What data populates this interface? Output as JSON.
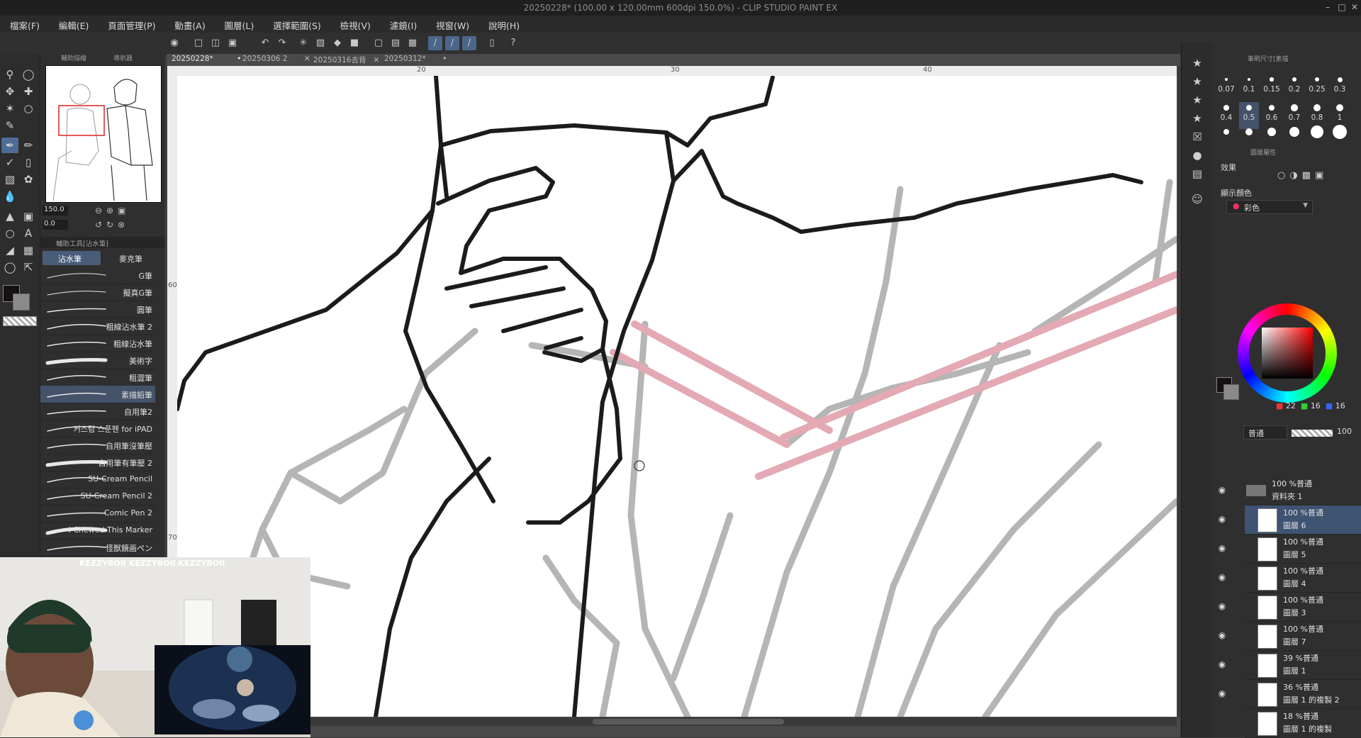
{
  "window": {
    "title": "20250228* (100.00 x 120.00mm 600dpi 150.0%)  - CLIP STUDIO PAINT EX",
    "minimize_icon": "minimize-icon",
    "maximize_icon": "maximize-icon",
    "close_icon": "close-icon"
  },
  "menu": [
    "檔案(F)",
    "編輯(E)",
    "頁面管理(P)",
    "動畫(A)",
    "圖層(L)",
    "選擇範圍(S)",
    "檢視(V)",
    "濾鏡(I)",
    "視窗(W)",
    "說明(H)"
  ],
  "document_tabs": [
    {
      "label": "20250228*",
      "active": true
    },
    {
      "label": "20250306 2",
      "active": false
    },
    {
      "label": "20250316去背",
      "active": false
    },
    {
      "label": "20250312*",
      "active": false
    }
  ],
  "rulers": {
    "top_marks": [
      "20",
      "30",
      "40"
    ],
    "left_marks": [
      "60",
      "70"
    ]
  },
  "navigator": {
    "tabs": [
      "輔助描繪",
      "導航器"
    ],
    "zoom": "150.0",
    "rotation": "0.0"
  },
  "subtool": {
    "panel_title": "輔助工具[沾水筆]",
    "groups": [
      "沾水筆",
      "麥克筆"
    ],
    "items": [
      {
        "label": "G筆",
        "selected": false
      },
      {
        "label": "擬真G筆",
        "selected": false
      },
      {
        "label": "圓筆",
        "selected": false
      },
      {
        "label": "粗線沾水筆 2",
        "selected": false
      },
      {
        "label": "粗線沾水筆",
        "selected": false
      },
      {
        "label": "美術字",
        "selected": false
      },
      {
        "label": "粗澀筆",
        "selected": false
      },
      {
        "label": "素描鉛筆",
        "selected": true
      },
      {
        "label": "自用筆2",
        "selected": false
      },
      {
        "label": "커스텀 스푼펜 for iPAD",
        "selected": false
      },
      {
        "label": "自用筆沒筆壓",
        "selected": false
      },
      {
        "label": "自用筆有筆壓 2",
        "selected": false
      },
      {
        "label": "SU-Cream Pencil",
        "selected": false
      },
      {
        "label": "SU-Cream Pencil 2",
        "selected": false
      },
      {
        "label": "Comic Pen 2",
        "selected": false
      },
      {
        "label": "I Chewed This Marker",
        "selected": false
      },
      {
        "label": "怪獣鏡画ペン",
        "selected": false
      }
    ]
  },
  "brush_size": {
    "panel_title": "筆刷尺寸[素描",
    "sizes": [
      "0.07",
      "0.1",
      "0.15",
      "0.2",
      "0.25",
      "0.3",
      "0.4",
      "0.5",
      "0.6",
      "0.7",
      "0.8",
      "1"
    ],
    "selected": "0.5"
  },
  "layer_property": {
    "panel_title": "圖層屬性",
    "effect_label": "效果",
    "display_color_label": "顯示顏色",
    "display_color_value": "彩色"
  },
  "color": {
    "r": "22",
    "g": "16",
    "b": "16",
    "main": "#161010",
    "sub": "#8a8a8a"
  },
  "layers": {
    "blend_mode": "普通",
    "opacity": "100",
    "rows": [
      {
        "line1": "100 %普通",
        "line2": "資料夾 1",
        "folder": true,
        "visible": true
      },
      {
        "line1": "100 %普通",
        "line2": "圖層 6",
        "selected": true,
        "visible": true
      },
      {
        "line1": "100 %普通",
        "line2": "圖層 5",
        "visible": true
      },
      {
        "line1": "100 %普通",
        "line2": "圖層 4",
        "visible": true
      },
      {
        "line1": "100 %普通",
        "line2": "圖層 3",
        "visible": true
      },
      {
        "line1": "100 %普通",
        "line2": "圖層 7",
        "visible": true
      },
      {
        "line1": "39 %普通",
        "line2": "圖層 1",
        "visible": true
      },
      {
        "line1": "36 %普通",
        "line2": "圖層 1 的複製 2",
        "visible": true
      },
      {
        "line1": "18 %普通",
        "line2": "圖層 1 的複製",
        "visible": false
      }
    ]
  },
  "stream": {
    "banner": "KEZZYBOII  KEZZYBOII  KEZZYBOII"
  }
}
